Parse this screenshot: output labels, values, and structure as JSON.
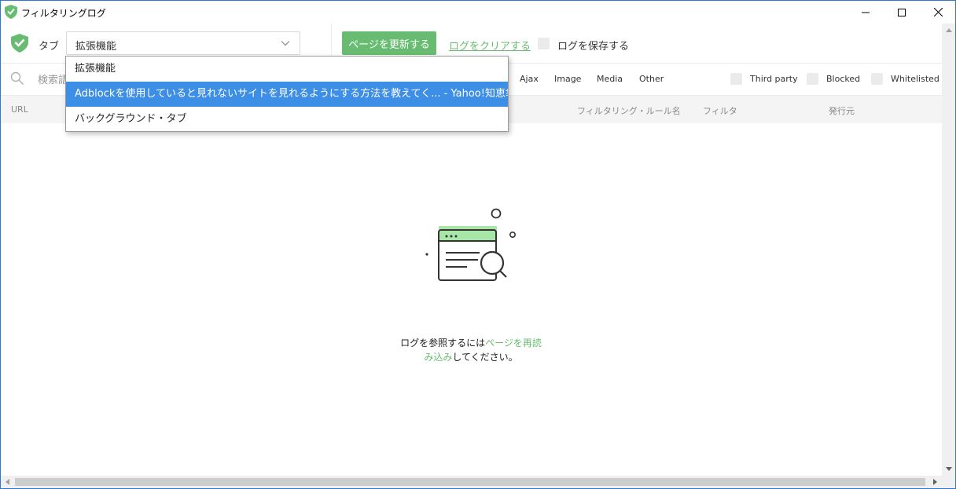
{
  "window": {
    "title": "フィルタリングログ"
  },
  "toolbar": {
    "tab_label": "タブ",
    "tab_selected": "拡張機能",
    "refresh_label": "ページを更新する",
    "clear_label": "ログをクリアする",
    "save_label": "ログを保存する"
  },
  "dropdown": {
    "options": [
      "拡張機能",
      "Adblockを使用していると見れないサイトを見れるようにする方法を教えてく... - Yahoo!知恵袋",
      "バックグラウンド・タブ"
    ]
  },
  "filters": {
    "search_placeholder": "検索語",
    "types": [
      "Ajax",
      "Image",
      "Media",
      "Other"
    ],
    "checks": [
      "Third party",
      "Blocked",
      "Whitelisted"
    ]
  },
  "table": {
    "columns": {
      "url": "URL",
      "rule": "フィルタリング・ルール名",
      "filter": "フィルタ",
      "source": "発行元"
    }
  },
  "empty": {
    "text1": "ログを参照するには",
    "link1": "ページを再読",
    "link2": "み込み",
    "text2": "してください。"
  },
  "colors": {
    "accent": "#68bc71",
    "selection": "#3d8ee6"
  }
}
